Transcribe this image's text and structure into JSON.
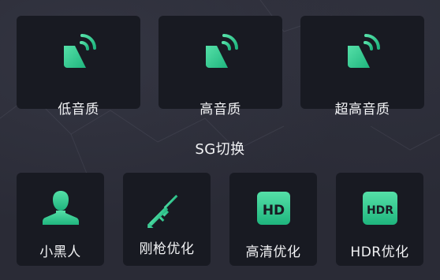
{
  "colors": {
    "accent": "#3ecf9a",
    "card_bg": "#181a22",
    "page_bg": "#2a2b36"
  },
  "quality_options": [
    {
      "label": "低音质",
      "icon": "speaker-icon"
    },
    {
      "label": "高音质",
      "icon": "speaker-icon"
    },
    {
      "label": "超高音质",
      "icon": "speaker-icon"
    }
  ],
  "sg_section": {
    "title": "SG切换"
  },
  "sg_options": [
    {
      "label": "小黑人",
      "icon": "person-icon"
    },
    {
      "label": "刚枪优化",
      "icon": "rifle-icon"
    },
    {
      "label": "高清优化",
      "icon": "hd-badge-icon",
      "badge": "HD"
    },
    {
      "label": "HDR优化",
      "icon": "hdr-badge-icon",
      "badge": "HDR"
    }
  ]
}
